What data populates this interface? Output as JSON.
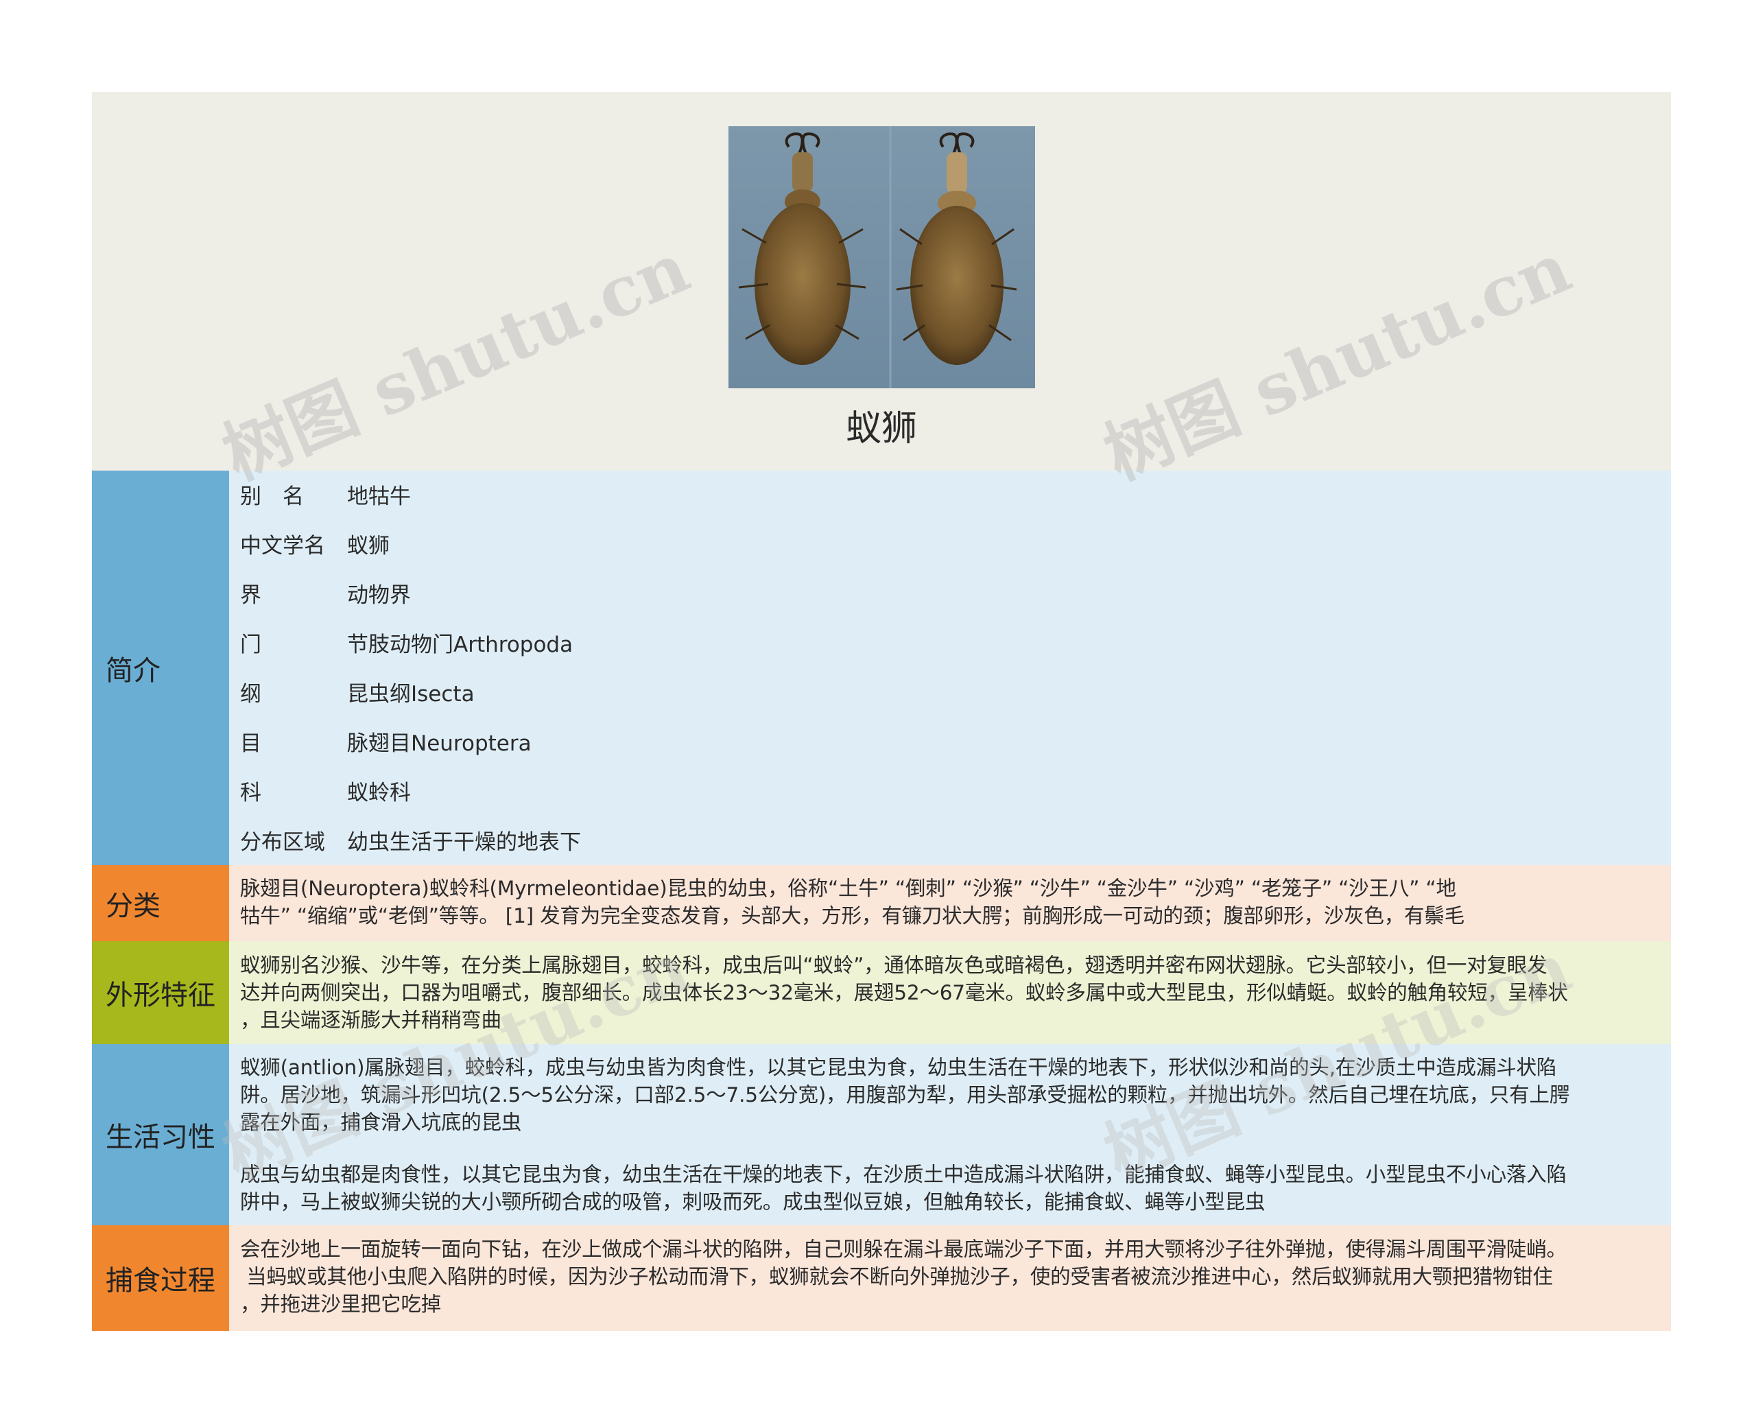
{
  "title": "蚁狮",
  "photo": {
    "alt": "蚁狮",
    "icon": "antlion-photo"
  },
  "colors": {
    "header_bg": "#eeede6",
    "blue_label": "#6aaed4",
    "blue_body": "#dfeef6",
    "orange_label": "#f0872f",
    "orange_body": "#fbe6da",
    "green_label": "#a6b81c",
    "green_body": "#eff3d5",
    "watermark": "#b9b9b9"
  },
  "watermark": "树图 shutu.cn",
  "sections": {
    "intro": {
      "label": "简介",
      "rows": [
        {
          "key": "别　名",
          "value": "地牯牛"
        },
        {
          "key": "中文学名",
          "value": "蚁狮"
        },
        {
          "key": "界",
          "value": "动物界"
        },
        {
          "key": "门",
          "value": "节肢动物门Arthropoda"
        },
        {
          "key": "纲",
          "value": "昆虫纲Isecta"
        },
        {
          "key": "目",
          "value": "脉翅目Neuroptera"
        },
        {
          "key": "科",
          "value": "蚁蛉科"
        },
        {
          "key": "分布区域",
          "value": "幼虫生活于干燥的地表下"
        }
      ]
    },
    "classification": {
      "label": "分类",
      "text": "脉翅目(Neuroptera)蚁蛉科(Myrmeleontidae)昆虫的幼虫，俗称“土牛” “倒刺” “沙猴” “沙牛” “金沙牛” “沙鸡” “老笼子” “沙王八” “地\n牯牛” “缩缩”或“老倒”等等。 [1] 发育为完全变态发育，头部大，方形，有镰刀状大腭；前胸形成一可动的颈；腹部卵形，沙灰色，有鬃毛"
    },
    "morphology": {
      "label": "外形特征",
      "text": "蚁狮别名沙猴、沙牛等，在分类上属脉翅目，蛟蛉科，成虫后叫“蚁蛉”，通体暗灰色或暗褐色，翅透明并密布网状翅脉。它头部较小，但一对复眼发\n达并向两侧突出，口器为咀嚼式，腹部细长。成虫体长23～32毫米，展翅52～67毫米。蚁蛉多属中或大型昆虫，形似蜻蜓。蚁蛉的触角较短，呈棒状\n，且尖端逐渐膨大并稍稍弯曲"
    },
    "habits": {
      "label": "生活习性",
      "text1": "蚁狮(antlion)属脉翅目，蛟蛉科，成虫与幼虫皆为肉食性，以其它昆虫为食，幼虫生活在干燥的地表下，形状似沙和尚的头,在沙质土中造成漏斗状陷\n阱。居沙地，筑漏斗形凹坑(2.5～5公分深，口部2.5～7.5公分宽)，用腹部为犁，用头部承受掘松的颗粒，并抛出坑外。然后自己埋在坑底，只有上腭\n露在外面，捕食滑入坑底的昆虫",
      "text2": "成虫与幼虫都是肉食性，以其它昆虫为食，幼虫生活在干燥的地表下，在沙质土中造成漏斗状陷阱，能捕食蚁、蝇等小型昆虫。小型昆虫不小心落入陷\n阱中，马上被蚁狮尖锐的大小颚所砌合成的吸管，刺吸而死。成虫型似豆娘，但触角较长，能捕食蚁、蝇等小型昆虫"
    },
    "predation": {
      "label": "捕食过程",
      "text": "会在沙地上一面旋转一面向下钻，在沙上做成个漏斗状的陷阱，自己则躲在漏斗最底端沙子下面，并用大颚将沙子往外弹抛，使得漏斗周围平滑陡峭。\n 当蚂蚁或其他小虫爬入陷阱的时候，因为沙子松动而滑下，蚁狮就会不断向外弹抛沙子，使的受害者被流沙推进中心，然后蚁狮就用大颚把猎物钳住\n，并拖进沙里把它吃掉"
    }
  }
}
